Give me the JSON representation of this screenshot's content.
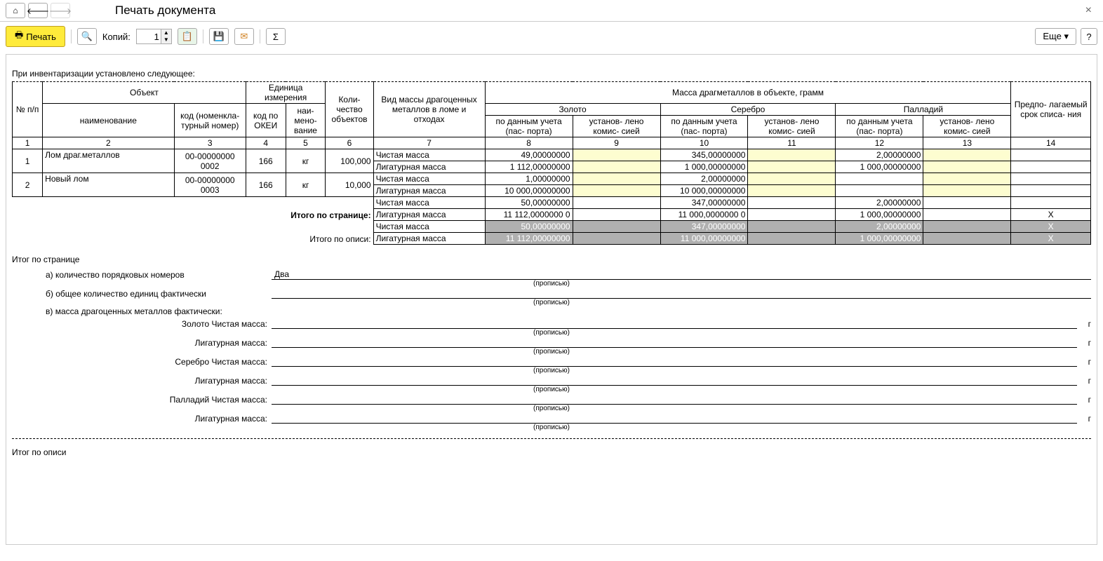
{
  "header": {
    "title": "Печать документа"
  },
  "toolbar": {
    "print": "Печать",
    "copies_label": "Копий:",
    "copies_value": "1",
    "more": "Еще",
    "help": "?"
  },
  "doc": {
    "intro": "При инвентаризации установлено следующее:",
    "th": {
      "npp": "№ п/п",
      "object": "Объект",
      "unit": "Единица измерения",
      "name": "наименование",
      "code": "код (номенкла- турный номер)",
      "okei": "код по ОКЕИ",
      "uname": "наи- мено- вание",
      "qty": "Коли- чество объектов",
      "masskind": "Вид массы драгоценных металлов в ломе и отходах",
      "massobj": "Масса драгметаллов в объекте, грамм",
      "gold": "Золото",
      "silver": "Серебро",
      "pall": "Палладий",
      "bydata": "по данным учета (пас- порта)",
      "bycom": "установ- лено комис- сией",
      "term": "Предпо- лагаемый срок списа- ния"
    },
    "colnums": [
      "1",
      "2",
      "3",
      "4",
      "5",
      "6",
      "7",
      "8",
      "9",
      "10",
      "11",
      "12",
      "13",
      "14"
    ],
    "rows": [
      {
        "n": "1",
        "name": "Лом драг.металлов",
        "code": "00-00000000 0002",
        "okei": "166",
        "unit": "кг",
        "qty": "100,000",
        "mass": [
          {
            "kind": "Чистая масса",
            "g1": "49,00000000",
            "g2": "",
            "s1": "345,00000000",
            "s2": "",
            "p1": "2,00000000",
            "p2": "",
            "t": ""
          },
          {
            "kind": "Лигатурная масса",
            "g1": "1 112,00000000",
            "g2": "",
            "s1": "1 000,00000000",
            "s2": "",
            "p1": "1 000,00000000",
            "p2": "",
            "t": ""
          }
        ]
      },
      {
        "n": "2",
        "name": "Новый лом",
        "code": "00-00000000 0003",
        "okei": "166",
        "unit": "кг",
        "qty": "10,000",
        "mass": [
          {
            "kind": "Чистая масса",
            "g1": "1,00000000",
            "g2": "",
            "s1": "2,00000000",
            "s2": "",
            "p1": "",
            "p2": "",
            "t": ""
          },
          {
            "kind": "Лигатурная масса",
            "g1": "10 000,00000000",
            "g2": "",
            "s1": "10 000,00000000",
            "s2": "",
            "p1": "",
            "p2": "",
            "t": ""
          }
        ]
      }
    ],
    "page_total_label": "Итого по странице:",
    "page_total": [
      {
        "kind": "Чистая масса",
        "g": "50,00000000",
        "s": "347,00000000",
        "p": "2,00000000",
        "t": ""
      },
      {
        "kind": "Лигатурная масса",
        "g": "11 112,0000000 0",
        "s": "11 000,0000000 0",
        "p": "1 000,00000000",
        "t": "X"
      }
    ],
    "inv_total_label": "Итого по описи:",
    "inv_total": [
      {
        "kind": "Чистая масса",
        "g": "50,00000000",
        "s": "347,00000000",
        "p": "2,00000000",
        "t": "X"
      },
      {
        "kind": "Лигатурная масса",
        "g": "11 112,00000000",
        "s": "11 000,00000000",
        "p": "1 000,00000000",
        "t": "X"
      }
    ],
    "sum_page_h": "Итог по странице",
    "sum_inv_h": "Итог по описи",
    "sum": {
      "a": "а) количество порядковых номеров",
      "a_val": "Два",
      "b": "б) общее количество единиц фактически",
      "c": "в) масса драгоценных металлов фактически:",
      "gold": "Золото",
      "silver": "Серебро",
      "pall": "Палладий",
      "pure": "Чистая масса:",
      "lig": "Лигатурная масса:",
      "hint": "(прописью)",
      "unit": "г"
    }
  }
}
